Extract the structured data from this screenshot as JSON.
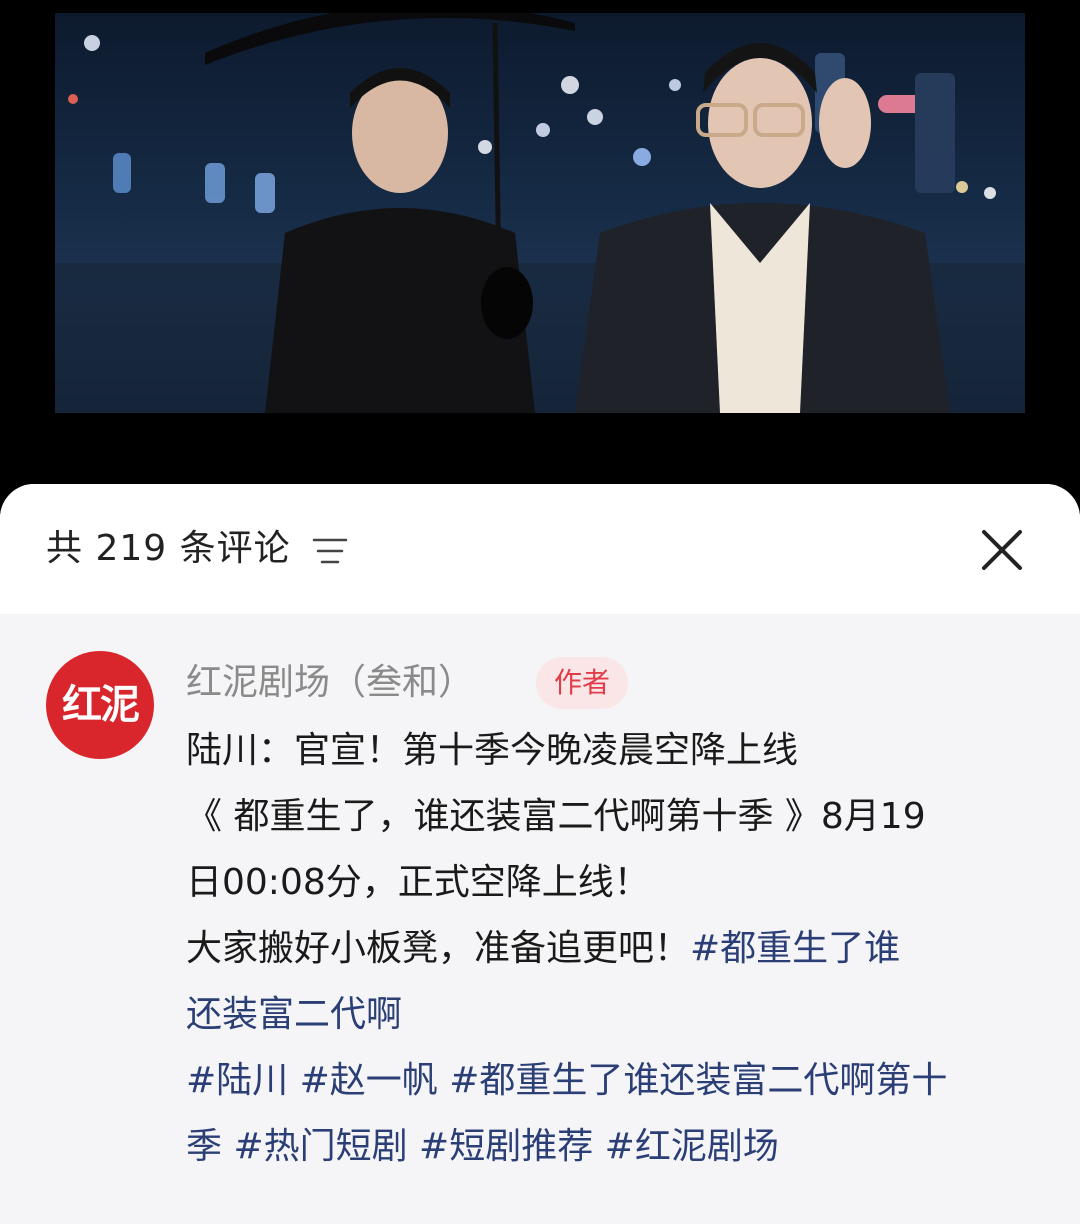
{
  "video": {
    "description_icon": "video-thumbnail-image"
  },
  "header": {
    "title": "共 219 条评论",
    "sort_icon": "sort-icon",
    "close_icon": "close-icon"
  },
  "comment": {
    "avatar_text": "红泥",
    "author": "红泥剧场（叁和）",
    "badge": "作者",
    "lines": [
      "陆川：官宣！第十季今晚凌晨空降上线",
      "《 都重生了，谁还装富二代啊第十季 》8月19",
      "日00:08分，正式空降上线！",
      "大家搬好小板凳，准备追更吧！"
    ],
    "inline_tag_part1": "#都重生了谁",
    "inline_tag_part2": "还装富二代啊",
    "tag_line1": "#陆川 #赵一帆 #都重生了谁还装富二代啊第十",
    "tag_line2": "季 #热门短剧 #短剧推荐 #红泥剧场"
  },
  "colors": {
    "sheet_bg": "#f5f5f7",
    "header_bg": "#ffffff",
    "badge_bg": "#fbe6e7",
    "badge_text": "#e23c48",
    "tag_color": "#2b3f76",
    "avatar_bg": "#d8262c"
  }
}
